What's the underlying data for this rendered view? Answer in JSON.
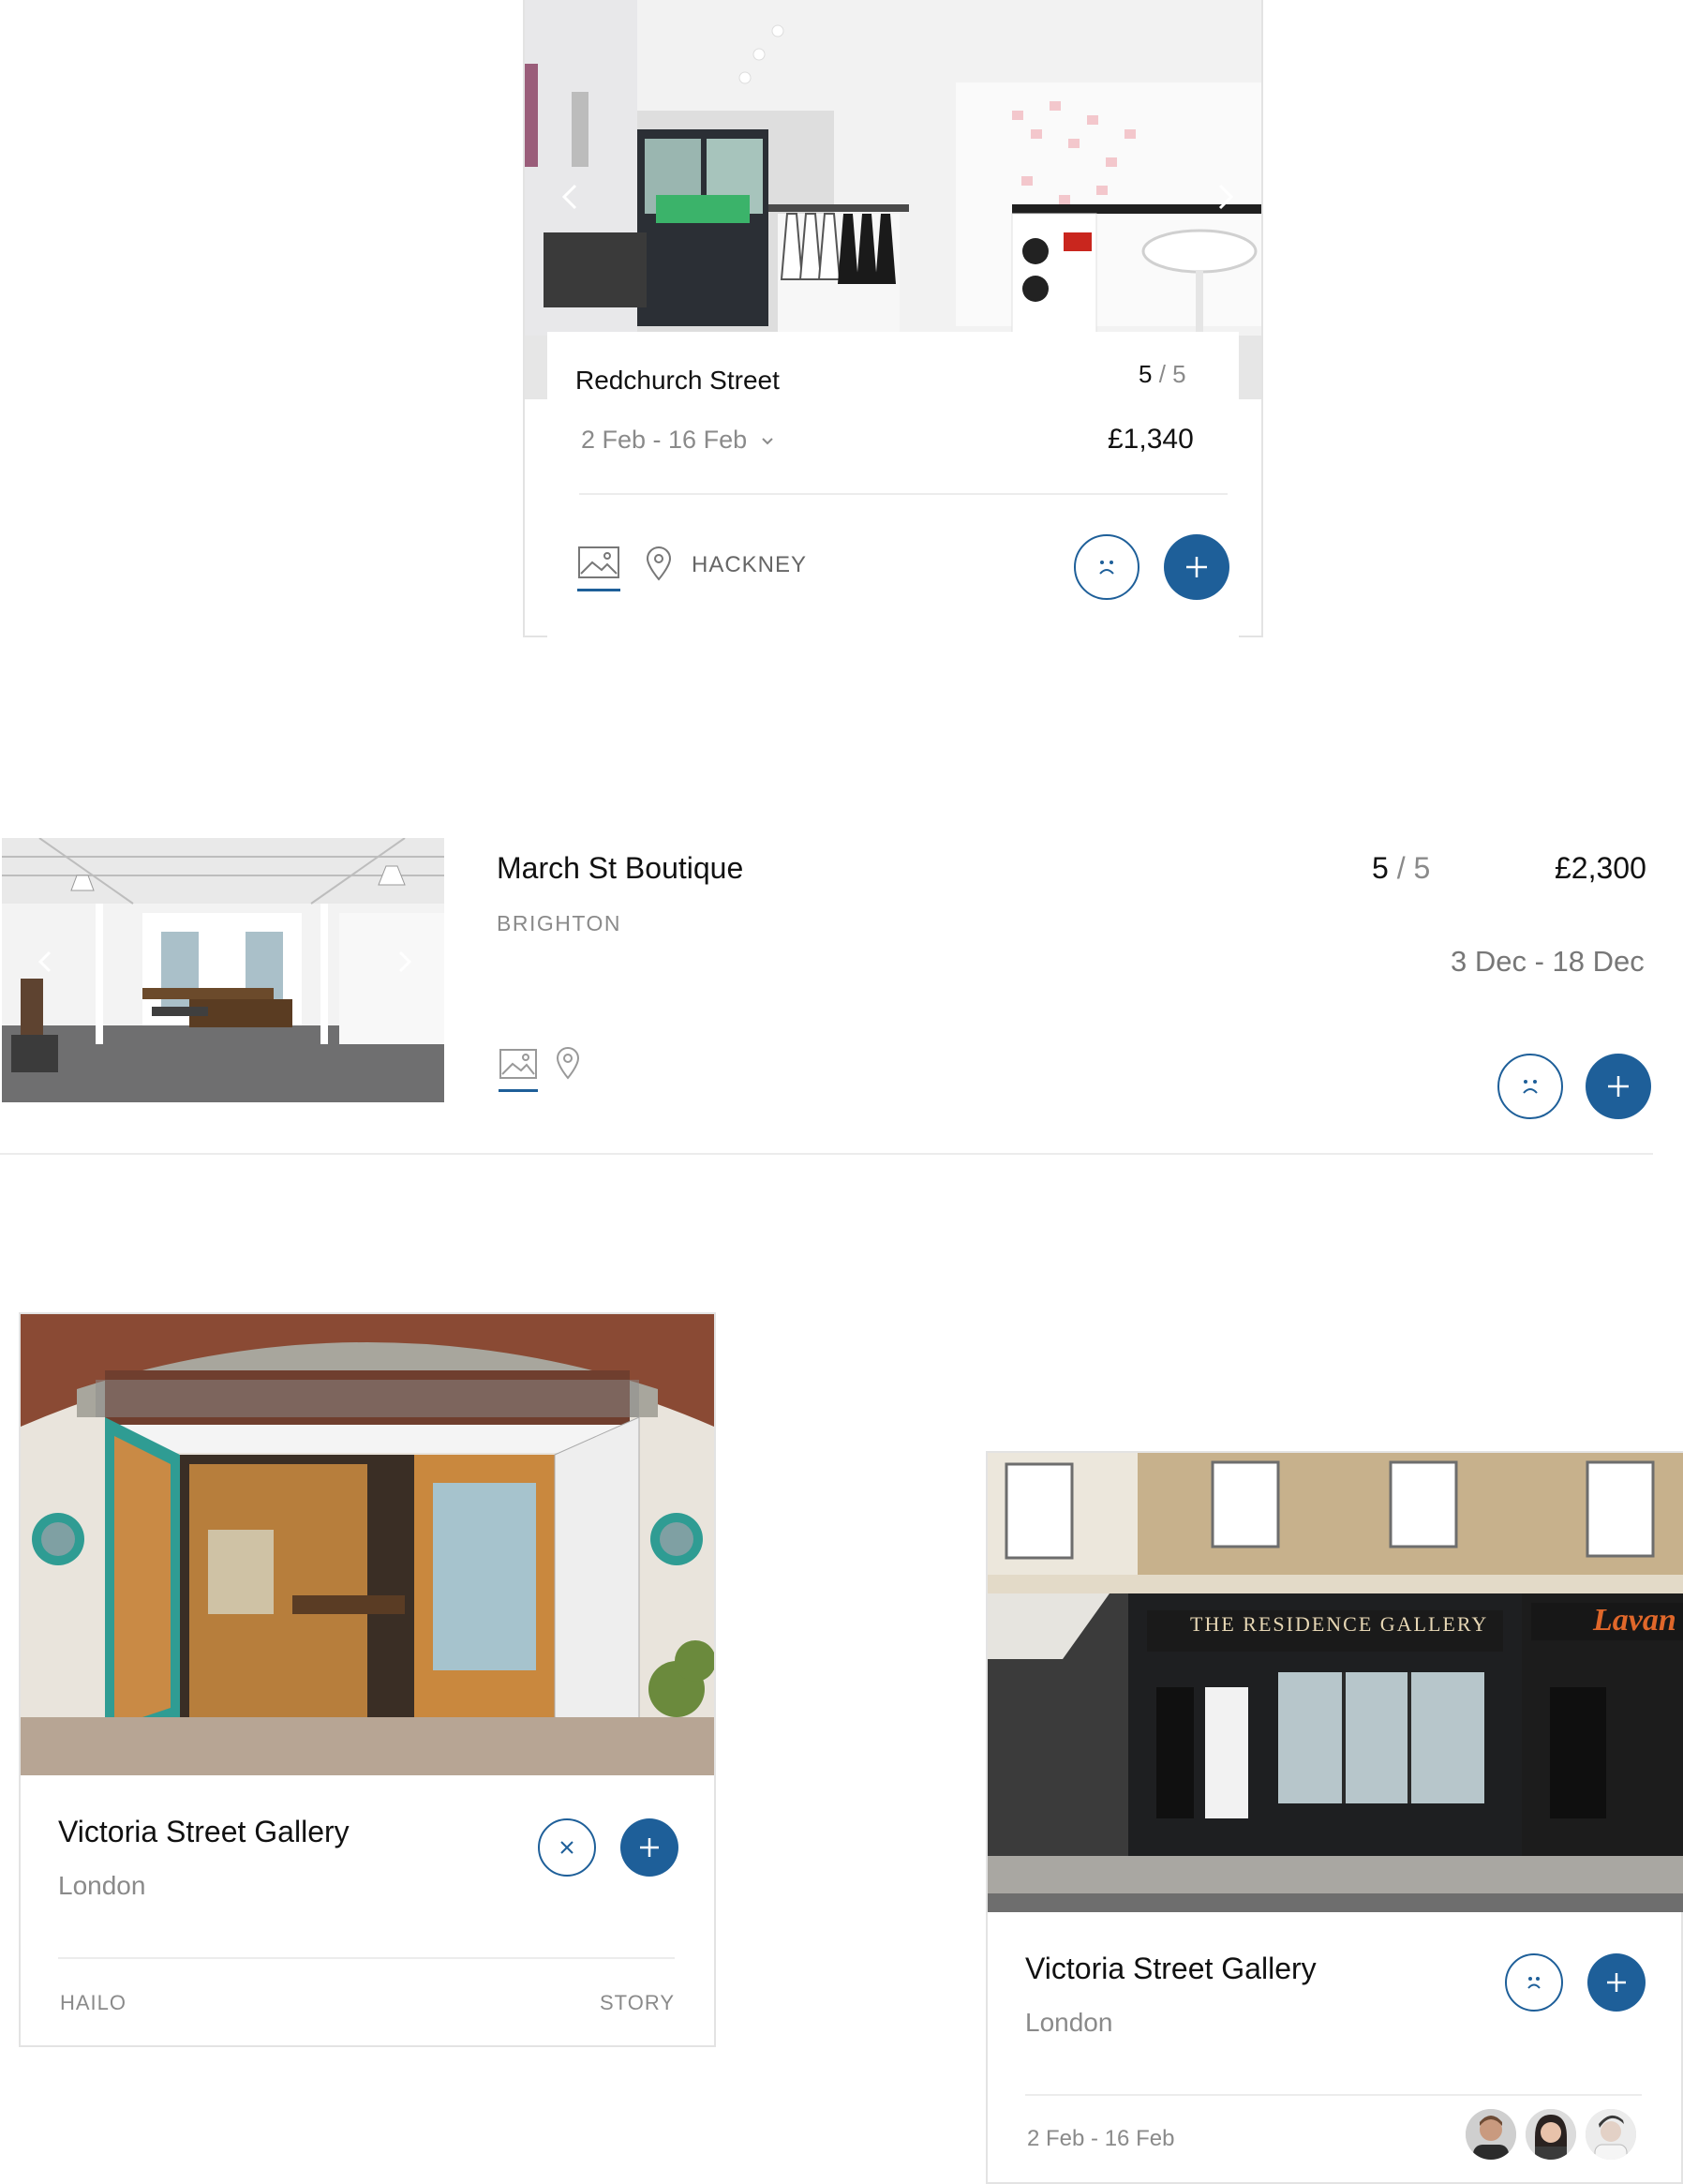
{
  "cards": {
    "redchurch": {
      "title": "Redchurch Street",
      "rating": "5",
      "rating_max": "/ 5",
      "dates": "2 Feb - 16 Feb",
      "price": "£1,340",
      "location": "HACKNEY",
      "icons": [
        "gallery-icon",
        "map-pin-icon",
        "sad-face-icon",
        "plus-icon",
        "chevron-left-icon",
        "chevron-right-icon",
        "chevron-down-icon"
      ]
    },
    "march": {
      "title": "March St Boutique",
      "location": "BRIGHTON",
      "rating": "5",
      "rating_max": "/ 5",
      "price": "£2,300",
      "dates": "3 Dec - 18 Dec",
      "icons": [
        "gallery-icon",
        "map-pin-icon",
        "sad-face-icon",
        "plus-icon",
        "chevron-left-icon",
        "chevron-right-icon"
      ]
    },
    "victoria_left": {
      "title": "Victoria Street Gallery",
      "subtitle": "London",
      "footer_left": "HAILO",
      "footer_right": "STORY",
      "icons": [
        "close-icon",
        "plus-icon"
      ]
    },
    "victoria_right": {
      "title": "Victoria Street Gallery",
      "subtitle": "London",
      "dates": "2 Feb - 16 Feb",
      "sign_text": "THE RESIDENCE GALLERY",
      "sign_text_2": "Lavan",
      "icons": [
        "sad-face-icon",
        "plus-icon",
        "avatar",
        "avatar",
        "avatar"
      ]
    }
  },
  "colors": {
    "accent": "#1e5f99",
    "muted": "#8a8a8a",
    "divider": "#ececec",
    "border": "#e3e3e3"
  }
}
